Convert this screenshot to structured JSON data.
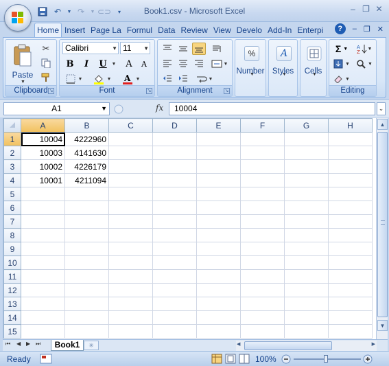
{
  "window": {
    "title": "Book1.csv - Microsoft Excel",
    "controls": [
      "–",
      "❐",
      "✕"
    ],
    "doc_controls": [
      "–",
      "❐",
      "✕"
    ]
  },
  "tabs": [
    {
      "label": "Home",
      "active": true
    },
    {
      "label": "Insert"
    },
    {
      "label": "Page La"
    },
    {
      "label": "Formul"
    },
    {
      "label": "Data"
    },
    {
      "label": "Review"
    },
    {
      "label": "View"
    },
    {
      "label": "Develo"
    },
    {
      "label": "Add-In"
    },
    {
      "label": "Enterpi"
    }
  ],
  "ribbon": {
    "clipboard": {
      "label": "Clipboard",
      "paste": "Paste"
    },
    "font": {
      "label": "Font",
      "name": "Calibri",
      "size": "11",
      "bold": "B",
      "italic": "I",
      "underline": "U",
      "grow": "A",
      "shrink": "A"
    },
    "alignment": {
      "label": "Alignment"
    },
    "number": {
      "label": "Number",
      "symbol": "%"
    },
    "styles": {
      "label": "Styles"
    },
    "cells": {
      "label": "Cells"
    },
    "editing": {
      "label": "Editing",
      "sum": "Σ"
    }
  },
  "formula_bar": {
    "name_box": "A1",
    "fx": "fx",
    "value": "10004"
  },
  "grid": {
    "columns": [
      "A",
      "B",
      "C",
      "D",
      "E",
      "F",
      "G",
      "H"
    ],
    "rows": [
      "1",
      "2",
      "3",
      "4",
      "5",
      "6",
      "7",
      "8",
      "9",
      "10",
      "11",
      "12",
      "13",
      "14",
      "15"
    ],
    "cells": [
      [
        "10004",
        "4222960"
      ],
      [
        "10003",
        "4141630"
      ],
      [
        "10002",
        "4226179"
      ],
      [
        "10001",
        "4211094"
      ]
    ],
    "active_cell": "A1"
  },
  "sheets": {
    "active": "Book1"
  },
  "status": {
    "ready": "Ready",
    "zoom": "100%"
  },
  "colors": {
    "accent": "#15428b",
    "selected_header": "#f1c15f",
    "ribbon": "#dbe8f8"
  }
}
